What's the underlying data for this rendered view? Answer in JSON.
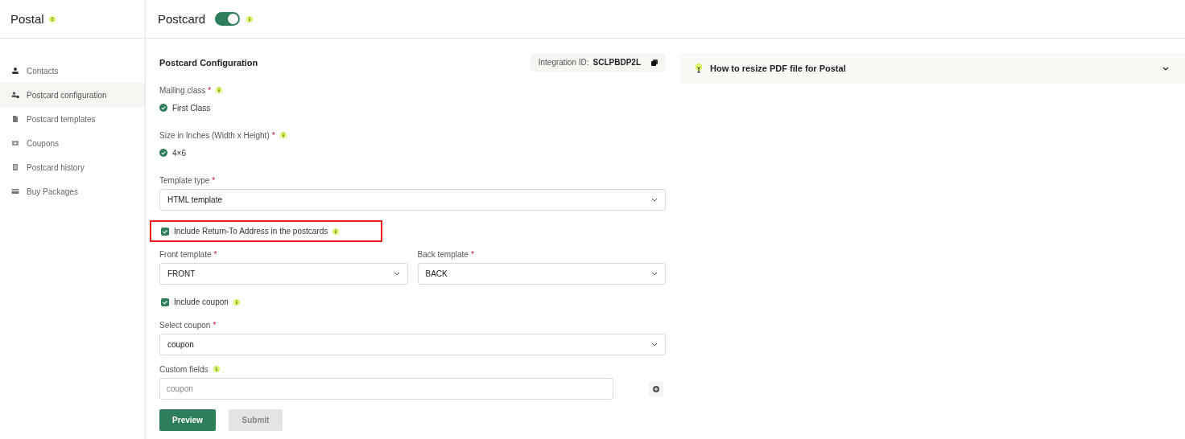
{
  "sidebar": {
    "title": "Postal",
    "items": [
      {
        "label": "Contacts",
        "selected": false
      },
      {
        "label": "Postcard configuration",
        "selected": true
      },
      {
        "label": "Postcard templates",
        "selected": false
      },
      {
        "label": "Coupons",
        "selected": false
      },
      {
        "label": "Postcard history",
        "selected": false
      },
      {
        "label": "Buy Packages",
        "selected": false
      }
    ]
  },
  "header": {
    "title": "Postcard",
    "enabled": true
  },
  "config": {
    "title": "Postcard Configuration",
    "integration_label": "Integration ID:",
    "integration_id": "SCLPBDP2L",
    "fields": [
      {
        "kind": "static",
        "label": "Mailing class",
        "mark": "*",
        "info": true,
        "value": "First Class"
      },
      {
        "kind": "static",
        "label": "Size in Inches (Width x Height)",
        "mark": "*",
        "info": true,
        "value": "4×6"
      },
      {
        "kind": "select",
        "label": "Template type",
        "mark": "*",
        "value": "HTML template"
      },
      {
        "kind": "checkbox",
        "label": "Include Return-To Address in the postcards",
        "info": true,
        "checked": true,
        "highlighted": true
      },
      {
        "kind": "pair",
        "items": [
          {
            "label": "Front template",
            "mark": "*",
            "value": "FRONT"
          },
          {
            "label": "Back template",
            "mark": "*",
            "value": "BACK"
          }
        ]
      },
      {
        "kind": "checkbox",
        "label": "Include coupon",
        "info": true,
        "checked": true,
        "highlighted": false
      },
      {
        "kind": "select",
        "label": "Select coupon",
        "mark": "*",
        "value": "coupon"
      },
      {
        "kind": "input",
        "label": "Custom fields",
        "info": true,
        "placeholder": "coupon"
      }
    ],
    "buttons": [
      {
        "label": "Preview",
        "disabled": false
      },
      {
        "label": "Submit",
        "disabled": true
      }
    ]
  },
  "help": {
    "title": "How to resize PDF file for Postal",
    "expanded": false
  }
}
